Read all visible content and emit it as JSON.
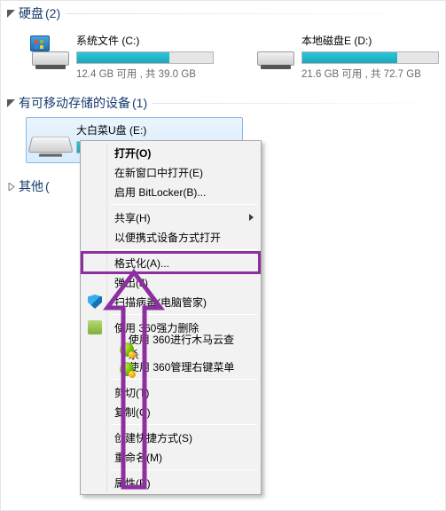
{
  "sections": {
    "hdd": {
      "label": "硬盘",
      "count": "(2)"
    },
    "removable": {
      "label": "有可移动存储的设备",
      "count": "(1)"
    },
    "other": {
      "label": "其他",
      "count": "("
    }
  },
  "drives": {
    "c": {
      "name": "系统文件 (C:)",
      "stats": "12.4 GB 可用 , 共 39.0 GB",
      "fill_pct": 68
    },
    "d": {
      "name": "本地磁盘E (D:)",
      "stats": "21.6 GB 可用 , 共 72.7 GB",
      "fill_pct": 70
    },
    "e": {
      "name": "大白菜U盘 (E:)",
      "stats": "",
      "fill_pct": 55
    }
  },
  "menu": {
    "open": "打开(O)",
    "open_new_window": "在新窗口中打开(E)",
    "bitlocker": "启用 BitLocker(B)...",
    "share": "共享(H)",
    "portable": "以便携式设备方式打开",
    "format": "格式化(A)...",
    "eject": "弹出(J)",
    "scan_virus": "扫描病毒(电脑管家)",
    "force_delete": "使用 360强力删除",
    "trojan_scan": "使用 360进行木马云查杀",
    "manage_menu": "使用 360管理右键菜单",
    "cut": "剪切(T)",
    "copy": "复制(C)",
    "shortcut": "创建快捷方式(S)",
    "rename": "重命名(M)",
    "properties": "属性(R)"
  }
}
